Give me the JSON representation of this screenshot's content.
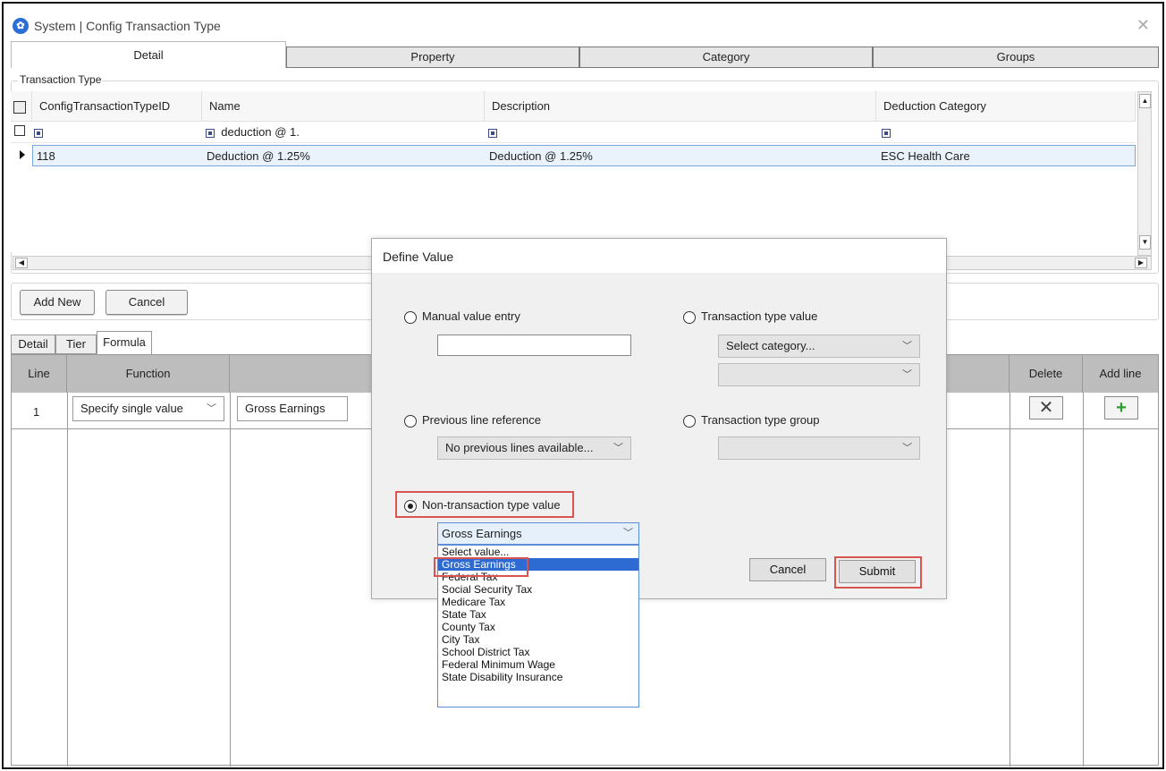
{
  "window": {
    "title": "System | Config Transaction Type",
    "close_glyph": "✕",
    "app_icon_glyph": "✿"
  },
  "top_tabs": [
    "Detail",
    "Property",
    "Category",
    "Groups"
  ],
  "transaction_group": {
    "label": "Transaction Type",
    "columns": [
      "ConfigTransactionTypeID",
      "Name",
      "Description",
      "Deduction Category"
    ],
    "filter_name": "deduction @ 1.",
    "rows": [
      {
        "id": "118",
        "name": "Deduction @ 1.25%",
        "description": "Deduction @ 1.25%",
        "category": "ESC Health Care"
      }
    ]
  },
  "buttons": {
    "add_new": "Add New",
    "cancel": "Cancel"
  },
  "sub_tabs": [
    "Detail",
    "Tier",
    "Formula"
  ],
  "formula": {
    "headers": {
      "line": "Line",
      "function": "Function",
      "delete": "Delete",
      "add_line": "Add line"
    },
    "rows": [
      {
        "line": "1",
        "function": "Specify single value",
        "value": "Gross Earnings"
      }
    ],
    "delete_glyph": "✕",
    "add_glyph": "+",
    "add_color": "#2e9b2e"
  },
  "dialog": {
    "title": "Define Value",
    "manual_label": "Manual value entry",
    "manual_value": "",
    "ttv_label": "Transaction type value",
    "ttv_category": "Select category...",
    "ttv_second": "",
    "prev_label": "Previous line reference",
    "prev_value": "No previous lines available...",
    "ttg_label": "Transaction type group",
    "ttg_value": "",
    "non_label": "Non-transaction type value",
    "non_selected": "Gross Earnings",
    "options": [
      "Select value...",
      "Gross Earnings",
      "Federal Tax",
      "Social Security Tax",
      "Medicare Tax",
      "State Tax",
      "County Tax",
      "City Tax",
      "School District Tax",
      "Federal Minimum Wage",
      "State Disability Insurance"
    ],
    "cancel": "Cancel",
    "submit": "Submit",
    "highlight_color": "#d9534f"
  }
}
